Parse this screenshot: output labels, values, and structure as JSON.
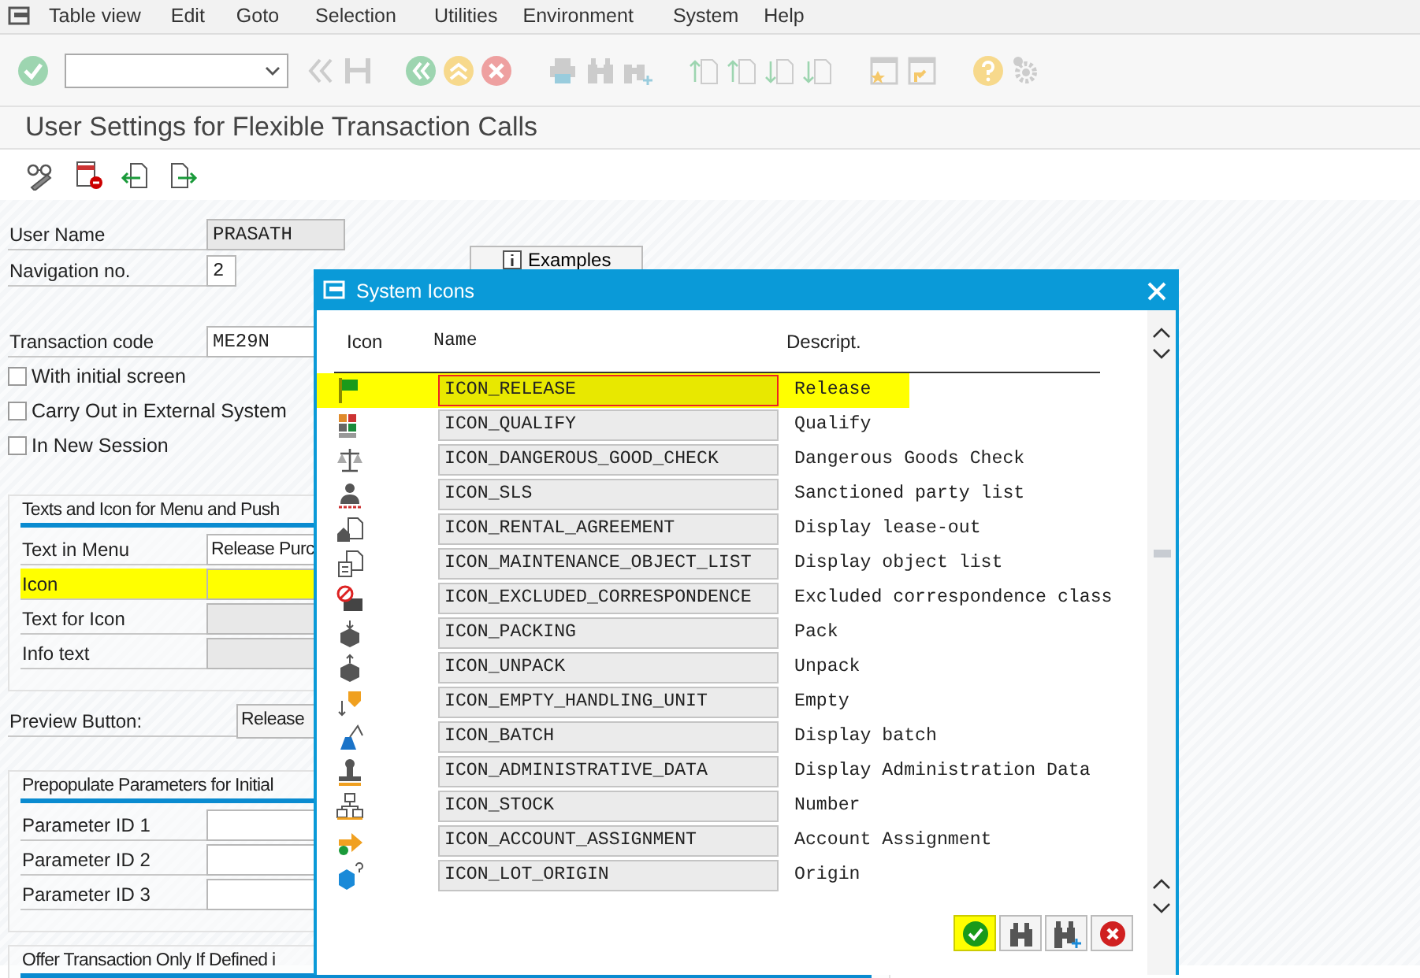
{
  "menu_bar": {
    "items": [
      "Table view",
      "Edit",
      "Goto",
      "Selection",
      "Utilities",
      "Environment",
      "System",
      "Help"
    ]
  },
  "screen_title": "User Settings for Flexible Transaction Calls",
  "form": {
    "fields": [
      {
        "label": "User Name",
        "value": "PRASATH",
        "editable": false
      },
      {
        "label": "Navigation no.",
        "value": "2",
        "editable": true
      }
    ],
    "examples_button": "Examples",
    "transaction_code": {
      "label": "Transaction code",
      "value": "ME29N"
    },
    "options": [
      {
        "label": "With initial screen",
        "checked": false
      },
      {
        "label": "Carry Out in External System",
        "checked": false
      },
      {
        "label": "In New Session",
        "checked": false
      }
    ]
  },
  "texts_group": {
    "title": "Texts and Icon for Menu and Push",
    "rows": [
      {
        "label": "Text in Menu",
        "value": "Release Purc",
        "editable": true,
        "highlighted": false
      },
      {
        "label": "Icon",
        "editable": true,
        "highlighted": true
      },
      {
        "label": "Text for Icon",
        "editable": false,
        "highlighted": false
      },
      {
        "label": "Info text",
        "editable": false,
        "highlighted": false
      }
    ]
  },
  "preview": {
    "label": "Preview Button:",
    "button": "Release"
  },
  "parameters_group": {
    "title": "Prepopulate Parameters for Initial",
    "rows": [
      {
        "label": "Parameter ID 1"
      },
      {
        "label": "Parameter ID 2"
      },
      {
        "label": "Parameter ID 3"
      }
    ]
  },
  "offer_group": {
    "title": "Offer Transaction Only If Defined i"
  },
  "dialog": {
    "title": "System Icons",
    "columns": [
      "Icon",
      "Name",
      "Descript."
    ],
    "rows": [
      {
        "name": "ICON_RELEASE",
        "description": "Release",
        "selected": true
      },
      {
        "name": "ICON_QUALIFY",
        "description": "Qualify",
        "selected": false
      },
      {
        "name": "ICON_DANGEROUS_GOOD_CHECK",
        "description": "Dangerous Goods Check",
        "selected": false
      },
      {
        "name": "ICON_SLS",
        "description": "Sanctioned party list",
        "selected": false
      },
      {
        "name": "ICON_RENTAL_AGREEMENT",
        "description": "Display lease-out",
        "selected": false
      },
      {
        "name": "ICON_MAINTENANCE_OBJECT_LIST",
        "description": "Display object list",
        "selected": false
      },
      {
        "name": "ICON_EXCLUDED_CORRESPONDENCE",
        "description": "Excluded correspondence class",
        "selected": false
      },
      {
        "name": "ICON_PACKING",
        "description": "Pack",
        "selected": false
      },
      {
        "name": "ICON_UNPACK",
        "description": "Unpack",
        "selected": false
      },
      {
        "name": "ICON_EMPTY_HANDLING_UNIT",
        "description": "Empty",
        "selected": false
      },
      {
        "name": "ICON_BATCH",
        "description": "Display batch",
        "selected": false
      },
      {
        "name": "ICON_ADMINISTRATIVE_DATA",
        "description": "Display Administration Data",
        "selected": false
      },
      {
        "name": "ICON_STOCK",
        "description": "Number",
        "selected": false
      },
      {
        "name": "ICON_ACCOUNT_ASSIGNMENT",
        "description": "Account Assignment",
        "selected": false
      },
      {
        "name": "ICON_LOT_ORIGIN",
        "description": "Origin",
        "selected": false
      }
    ],
    "buttons": [
      {
        "kind": "ok",
        "highlighted": true
      },
      {
        "kind": "find",
        "highlighted": false
      },
      {
        "kind": "find_next",
        "highlighted": false
      },
      {
        "kind": "cancel",
        "highlighted": false
      }
    ]
  }
}
